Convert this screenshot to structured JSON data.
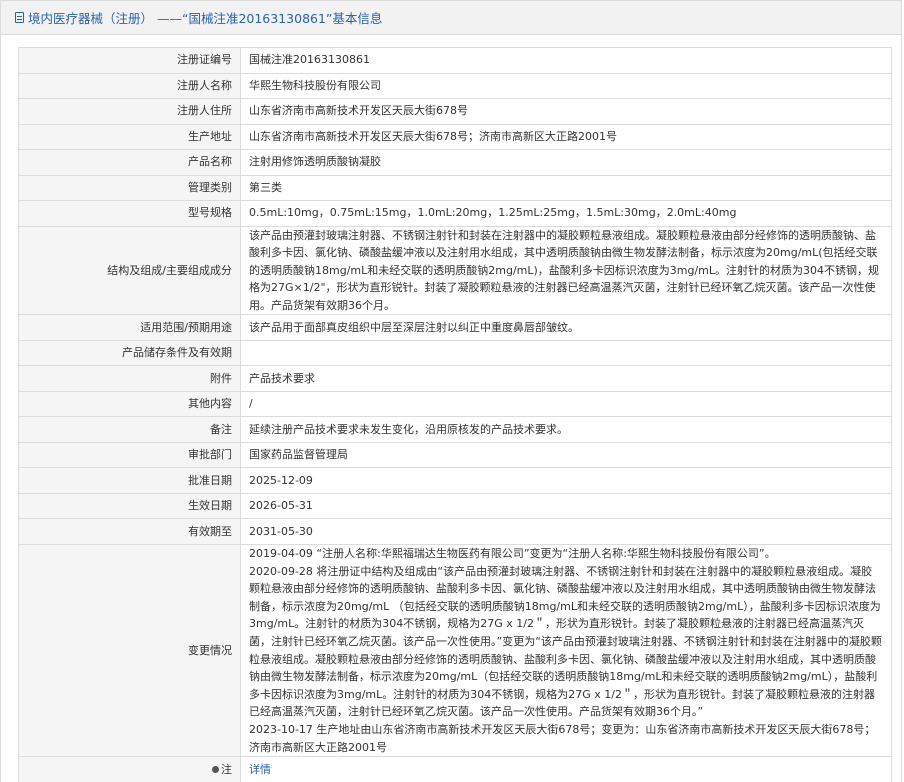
{
  "header": {
    "title": "境内医疗器械（注册）  ——“国械注准20163130861”基本信息"
  },
  "rows": {
    "reg_no": {
      "label": "注册证编号",
      "value": "国械注准20163130861"
    },
    "registrant": {
      "label": "注册人名称",
      "value": "华熙生物科技股份有限公司"
    },
    "registrant_address": {
      "label": "注册人住所",
      "value": "山东省济南市高新技术开发区天辰大街678号"
    },
    "production_address": {
      "label": "生产地址",
      "value": "山东省济南市高新技术开发区天辰大街678号；济南市高新区大正路2001号"
    },
    "product_name": {
      "label": "产品名称",
      "value": "注射用修饰透明质酸钠凝胶"
    },
    "category": {
      "label": "管理类别",
      "value": "第三类"
    },
    "model_spec": {
      "label": "型号规格",
      "value": "0.5mL:10mg，0.75mL:15mg，1.0mL:20mg，1.25mL:25mg，1.5mL:30mg，2.0mL:40mg"
    },
    "composition": {
      "label": "结构及组成/主要组成成分",
      "value": "该产品由预灌封玻璃注射器、不锈钢注射针和封装在注射器中的凝胶颗粒悬液组成。凝胶颗粒悬液由部分经修饰的透明质酸钠、盐酸利多卡因、氯化钠、磷酸盐缓冲液以及注射用水组成，其中透明质酸钠由微生物发酵法制备，标示浓度为20mg/mL(包括经交联的透明质酸钠18mg/mL和未经交联的透明质酸钠2mg/mL)，盐酸利多卡因标识浓度为3mg/mL。注射针的材质为304不锈钢，规格为27G×1/2\"，形状为直形锐针。封装了凝胶颗粒悬液的注射器已经高温蒸汽灭菌，注射针已经环氧乙烷灭菌。该产品一次性使用。产品货架有效期36个月。"
    },
    "scope": {
      "label": "适用范围/预期用途",
      "value": "该产品用于面部真皮组织中层至深层注射以纠正中重度鼻唇部皱纹。"
    },
    "storage": {
      "label": "产品储存条件及有效期",
      "value": ""
    },
    "attachment": {
      "label": "附件",
      "value": "产品技术要求"
    },
    "other": {
      "label": "其他内容",
      "value": "/"
    },
    "remark": {
      "label": "备注",
      "value": "延续注册产品技术要求未发生变化，沿用原核发的产品技术要求。"
    },
    "approval_dept": {
      "label": "审批部门",
      "value": "国家药品监督管理局"
    },
    "approval_date": {
      "label": "批准日期",
      "value": "2025-12-09"
    },
    "effective_date": {
      "label": "生效日期",
      "value": "2026-05-31"
    },
    "expiry_date": {
      "label": "有效期至",
      "value": "2031-05-30"
    },
    "changes": {
      "label": "变更情况",
      "lines": [
        "2019-04-09 “注册人名称:华熙福瑞达生物医药有限公司”变更为“注册人名称:华熙生物科技股份有限公司”。",
        "2020-09-28 将注册证中结构及组成由“该产品由预灌封玻璃注射器、不锈钢注射针和封装在注射器中的凝胶颗粒悬液组成。凝胶颗粒悬液由部分经修饰的透明质酸钠、盐酸利多卡因、氯化钠、磷酸盐缓冲液以及注射用水组成，其中透明质酸钠由微生物发酵法制备，标示浓度为20mg/mL （包括经交联的透明质酸钠18mg/mL和未经交联的透明质酸钠2mg/mL），盐酸利多卡因标识浓度为3mg/mL。注射针的材质为304不锈钢，规格为27G x 1/2＂，形状为直形锐针。封装了凝胶颗粒悬液的注射器已经高温蒸汽灭菌，注射针已经环氧乙烷灭菌。该产品一次性使用。”变更为“该产品由预灌封玻璃注射器、不锈钢注射针和封装在注射器中的凝胶颗粒悬液组成。凝胶颗粒悬液由部分经修饰的透明质酸钠、盐酸利多卡因、氯化钠、磷酸盐缓冲液以及注射用水组成，其中透明质酸钠由微生物发酵法制备，标示浓度为20mg/mL（包括经交联的透明质酸钠18mg/mL和未经交联的透明质酸钠2mg/mL），盐酸利多卡因标识浓度为3mg/mL。注射针的材质为304不锈钢，规格为27G x 1/2＂，形状为直形锐针。封装了凝胶颗粒悬液的注射器已经高温蒸汽灭菌，注射针已经环氧乙烷灭菌。该产品一次性使用。产品货架有效期36个月。”",
        "2023-10-17 生产地址由山东省济南市高新技术开发区天辰大街678号；变更为：山东省济南市高新技术开发区天辰大街678号；济南市高新区大正路2001号"
      ]
    },
    "note": {
      "label": "注",
      "value": "详情"
    }
  },
  "icons": {
    "header": "document-icon",
    "note": "note-icon"
  },
  "colors": {
    "link": "#2a63a8",
    "label_bg": "#f5f5f5",
    "border": "#dcdcdc",
    "header_bg": "#f2f2f2"
  }
}
